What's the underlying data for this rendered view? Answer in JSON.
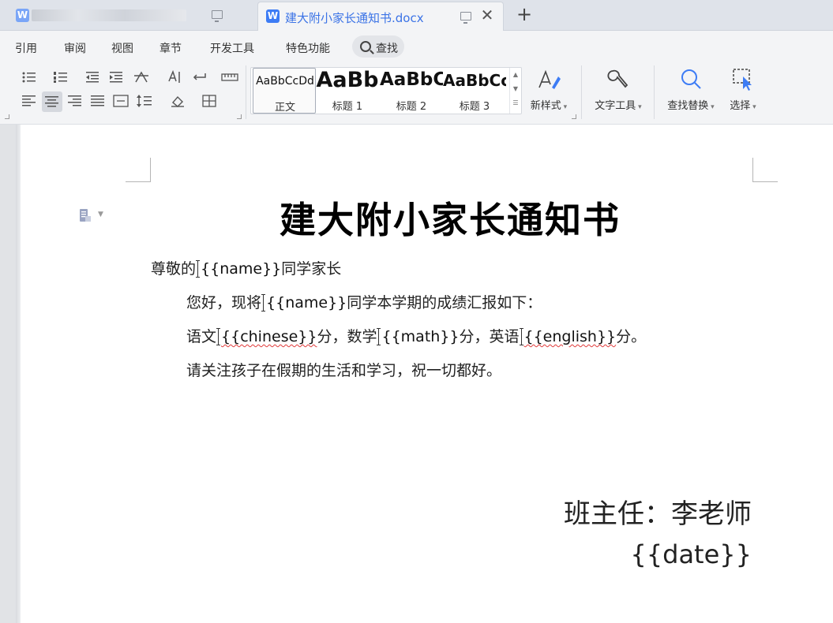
{
  "tabs": {
    "inactive_title": "",
    "active_title": "建大附小家长通知书.docx",
    "active_icon": "W"
  },
  "menu": {
    "items": [
      "引用",
      "审阅",
      "视图",
      "章节",
      "开发工具",
      "特色功能"
    ],
    "find_label": "查找"
  },
  "ribbon": {
    "styles": [
      {
        "sample": "AaBbCcDd",
        "name": "正文"
      },
      {
        "sample": "AaBb",
        "name": "标题 1"
      },
      {
        "sample": "AaBbC",
        "name": "标题 2"
      },
      {
        "sample": "AaBbCc",
        "name": "标题 3"
      }
    ],
    "new_style_label": "新样式",
    "text_tools_label": "文字工具",
    "find_replace_label": "查找替换",
    "select_label": "选择"
  },
  "document": {
    "title": "建大附小家长通知书",
    "greeting_pre": "尊敬的",
    "greeting_field": "{{name}}",
    "greeting_post": "同学家长",
    "line2_pre": "您好，现将",
    "line2_field": "{{name}}",
    "line2_post": "同学本学期的成绩汇报如下：",
    "line3_a": "语文",
    "line3_field1": "{{chinese}}",
    "line3_b": "分，数学",
    "line3_field2": "{{math}}",
    "line3_c": "分，英语",
    "line3_field3": "{{english}}",
    "line3_d": "分。",
    "line4": "请关注孩子在假期的生活和学习，祝一切都好。",
    "signature": "班主任：李老师",
    "date": "{{date}}"
  },
  "colors": {
    "accent": "#3d7cf5",
    "tab_title": "#3b73e6",
    "spell_underline": "#e03a3a"
  }
}
